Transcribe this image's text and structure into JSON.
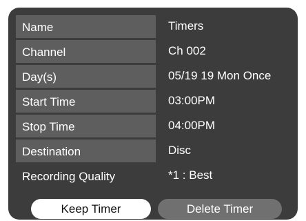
{
  "fields": [
    {
      "label": "Name",
      "value": "Timers"
    },
    {
      "label": "Channel",
      "value": "Ch 002"
    },
    {
      "label": "Day(s)",
      "value": "05/19 19 Mon Once"
    },
    {
      "label": "Start Time",
      "value": "03:00PM"
    },
    {
      "label": "Stop Time",
      "value": "04:00PM"
    },
    {
      "label": "Destination",
      "value": "Disc"
    },
    {
      "label": "Recording Quality",
      "value": "*1 : Best"
    }
  ],
  "buttons": {
    "keep_label": "Keep Timer",
    "delete_label": "Delete Timer"
  },
  "colors": {
    "panel_background": "#3c3c3c",
    "label_box": "#5e5e5e",
    "selected_button": "#ffffff",
    "unselected_button": "#707070"
  }
}
